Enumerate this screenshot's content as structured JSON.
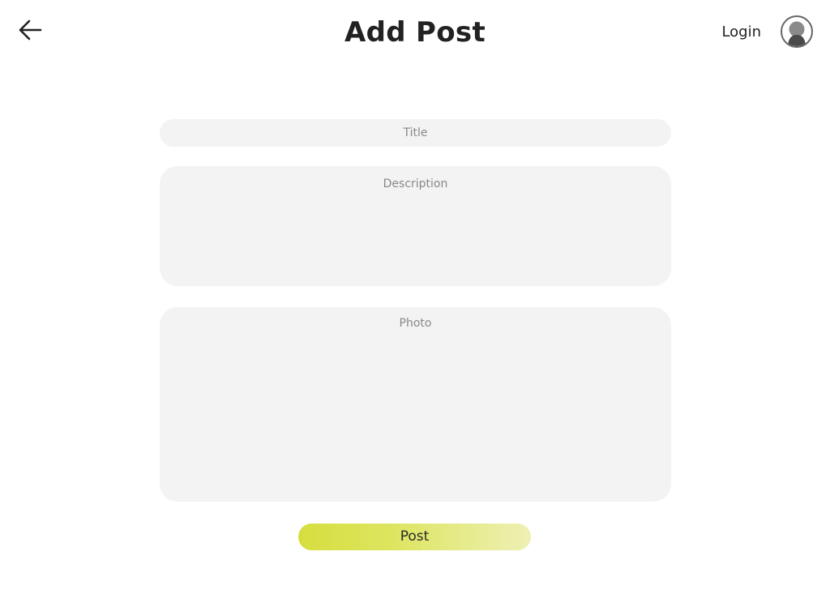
{
  "header": {
    "title": "Add Post",
    "login_label": "Login",
    "back_icon": "arrow-left-icon",
    "avatar_icon": "user-avatar-icon"
  },
  "form": {
    "title_placeholder": "Title",
    "description_placeholder": "Description",
    "photo_placeholder": "Photo",
    "submit_label": "Post"
  },
  "colors": {
    "field_background": "#f3f3f3",
    "button_gradient_start": "#d6de3e",
    "button_gradient_end": "#eef0b4",
    "text": "#222222",
    "placeholder": "#888888"
  }
}
